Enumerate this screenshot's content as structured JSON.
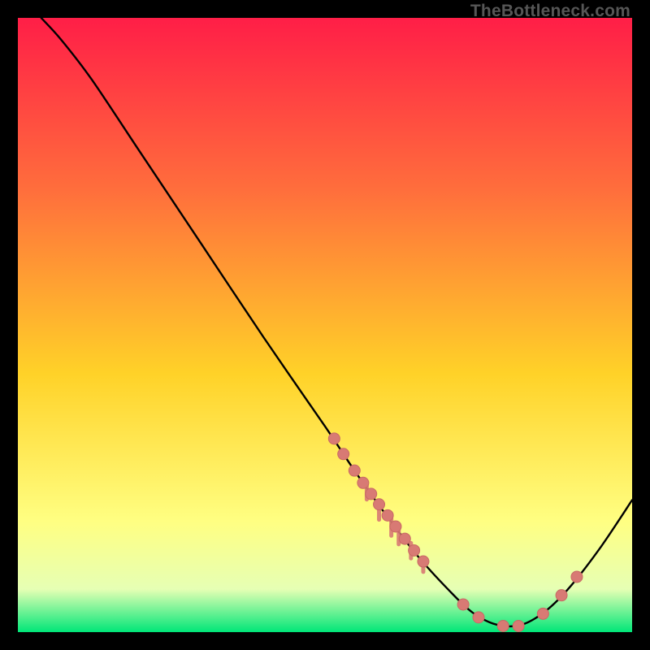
{
  "watermark": "TheBottleneck.com",
  "colors": {
    "gradient_top_rgb": "255,30,71",
    "gradient_mid1_rgb": "255,110,60",
    "gradient_mid2_rgb": "255,210,40",
    "gradient_mid3_rgb": "255,255,130",
    "gradient_mid4_rgb": "230,255,180",
    "gradient_bottom_rgb": "0,230,120",
    "curve_stroke": "#000000",
    "marker_fill": "#d87a74",
    "marker_stroke": "#c86a64"
  },
  "chart_data": {
    "type": "line",
    "title": "",
    "xlabel": "",
    "ylabel": "",
    "xlim": [
      0,
      100
    ],
    "ylim": [
      0,
      100
    ],
    "curve": [
      {
        "x": 3.8,
        "y": 100
      },
      {
        "x": 7,
        "y": 96.5
      },
      {
        "x": 12,
        "y": 90
      },
      {
        "x": 20,
        "y": 78
      },
      {
        "x": 30,
        "y": 63
      },
      {
        "x": 40,
        "y": 48
      },
      {
        "x": 50,
        "y": 33.5
      },
      {
        "x": 55,
        "y": 26
      },
      {
        "x": 60,
        "y": 19
      },
      {
        "x": 65,
        "y": 12.5
      },
      {
        "x": 70,
        "y": 7
      },
      {
        "x": 74,
        "y": 3.2
      },
      {
        "x": 78,
        "y": 1.2
      },
      {
        "x": 82,
        "y": 1.2
      },
      {
        "x": 86,
        "y": 3.5
      },
      {
        "x": 90,
        "y": 7.5
      },
      {
        "x": 95,
        "y": 14
      },
      {
        "x": 100,
        "y": 21.5
      }
    ],
    "markers": [
      {
        "x": 51.5,
        "y": 31.5
      },
      {
        "x": 53.0,
        "y": 29.0
      },
      {
        "x": 54.8,
        "y": 26.3
      },
      {
        "x": 56.2,
        "y": 24.3
      },
      {
        "x": 57.5,
        "y": 22.5
      },
      {
        "x": 58.8,
        "y": 20.8
      },
      {
        "x": 60.2,
        "y": 19.0
      },
      {
        "x": 61.5,
        "y": 17.2
      },
      {
        "x": 63.0,
        "y": 15.2
      },
      {
        "x": 64.5,
        "y": 13.3
      },
      {
        "x": 66.0,
        "y": 11.5
      },
      {
        "x": 72.5,
        "y": 4.5
      },
      {
        "x": 75.0,
        "y": 2.4
      },
      {
        "x": 79.0,
        "y": 1.0
      },
      {
        "x": 81.5,
        "y": 1.0
      },
      {
        "x": 85.5,
        "y": 3.0
      },
      {
        "x": 88.5,
        "y": 6.0
      },
      {
        "x": 91.0,
        "y": 9.0
      }
    ],
    "drips": [
      {
        "x": 56.8,
        "y_top": 24.0,
        "y_bot": 21.6
      },
      {
        "x": 58.8,
        "y_top": 21.0,
        "y_bot": 18.3
      },
      {
        "x": 60.8,
        "y_top": 18.5,
        "y_bot": 15.7
      },
      {
        "x": 62.0,
        "y_top": 17.0,
        "y_bot": 14.3
      },
      {
        "x": 64.0,
        "y_top": 14.5,
        "y_bot": 12.0
      },
      {
        "x": 66.0,
        "y_top": 12.0,
        "y_bot": 9.8
      }
    ]
  }
}
